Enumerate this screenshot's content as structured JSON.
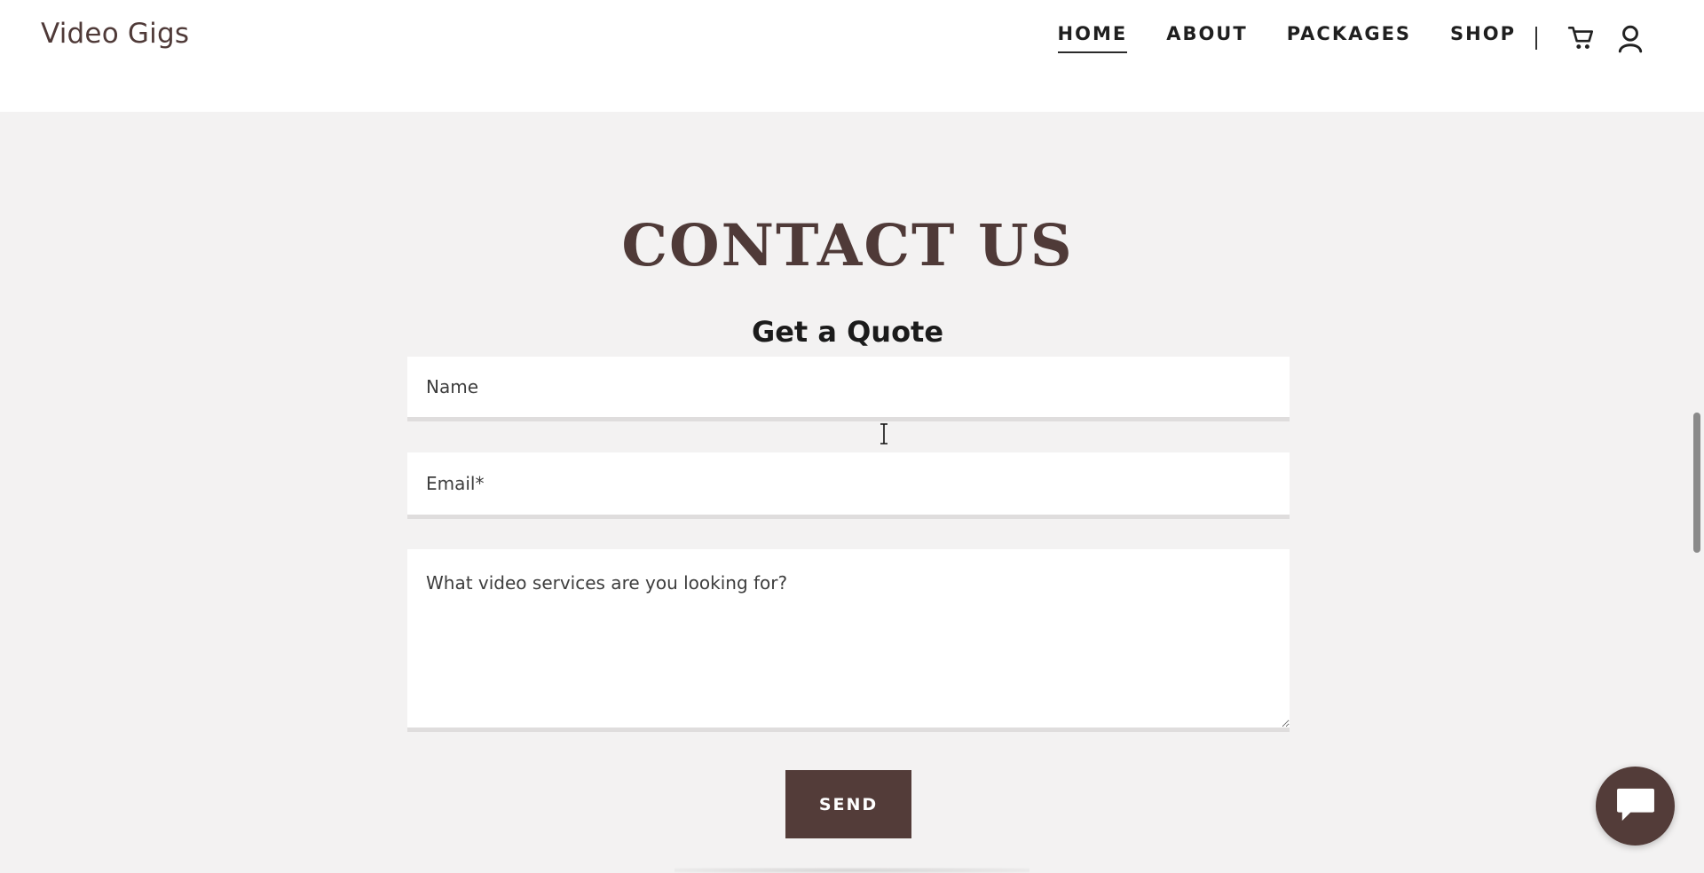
{
  "header": {
    "brand": "Video Gigs",
    "nav": [
      "HOME",
      "ABOUT",
      "PACKAGES",
      "SHOP"
    ],
    "active_nav": "HOME",
    "separator": "|",
    "icons": [
      "cart-icon",
      "user-icon"
    ]
  },
  "contact": {
    "title": "CONTACT US",
    "subtitle": "Get a Quote",
    "name_placeholder": "Name",
    "email_placeholder": "Email*",
    "message_placeholder": "What video services are you looking for?",
    "send_label": "SEND"
  },
  "colors": {
    "accent": "#533c39",
    "background": "#f3f2f2",
    "header_background": "#ffffff"
  },
  "widgets": {
    "chat_icon": "chat-bubble-icon"
  }
}
